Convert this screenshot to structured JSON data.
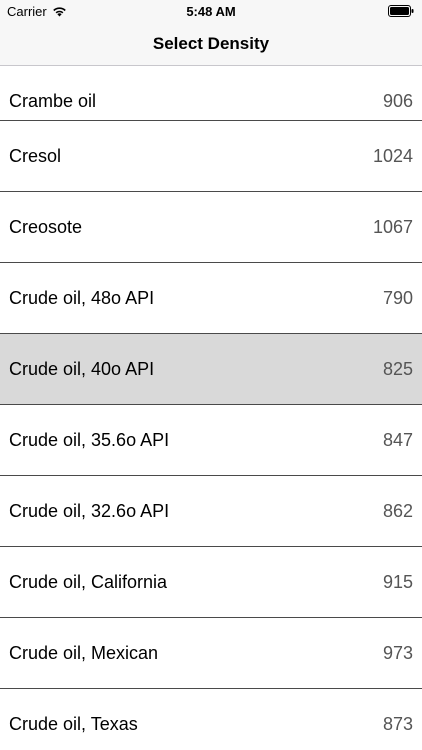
{
  "status_bar": {
    "carrier": "Carrier",
    "time": "5:48 AM",
    "wifi_icon": "wifi-icon",
    "battery_icon": "battery-icon"
  },
  "nav": {
    "title": "Select Density"
  },
  "list": {
    "selected_index": 4,
    "colors": {
      "selected_row": "#d9d9d9",
      "separator": "#4a4a4a",
      "value_text": "#555555"
    },
    "items": [
      {
        "label": "Crambe oil",
        "value": "906"
      },
      {
        "label": "Cresol",
        "value": "1024"
      },
      {
        "label": "Creosote",
        "value": "1067"
      },
      {
        "label": "Crude oil, 48o API",
        "value": "790"
      },
      {
        "label": "Crude oil, 40o API",
        "value": "825"
      },
      {
        "label": "Crude oil, 35.6o API",
        "value": "847"
      },
      {
        "label": "Crude oil, 32.6o API",
        "value": "862"
      },
      {
        "label": "Crude oil, California",
        "value": "915"
      },
      {
        "label": "Crude oil, Mexican",
        "value": "973"
      },
      {
        "label": "Crude oil, Texas",
        "value": "873"
      }
    ]
  }
}
